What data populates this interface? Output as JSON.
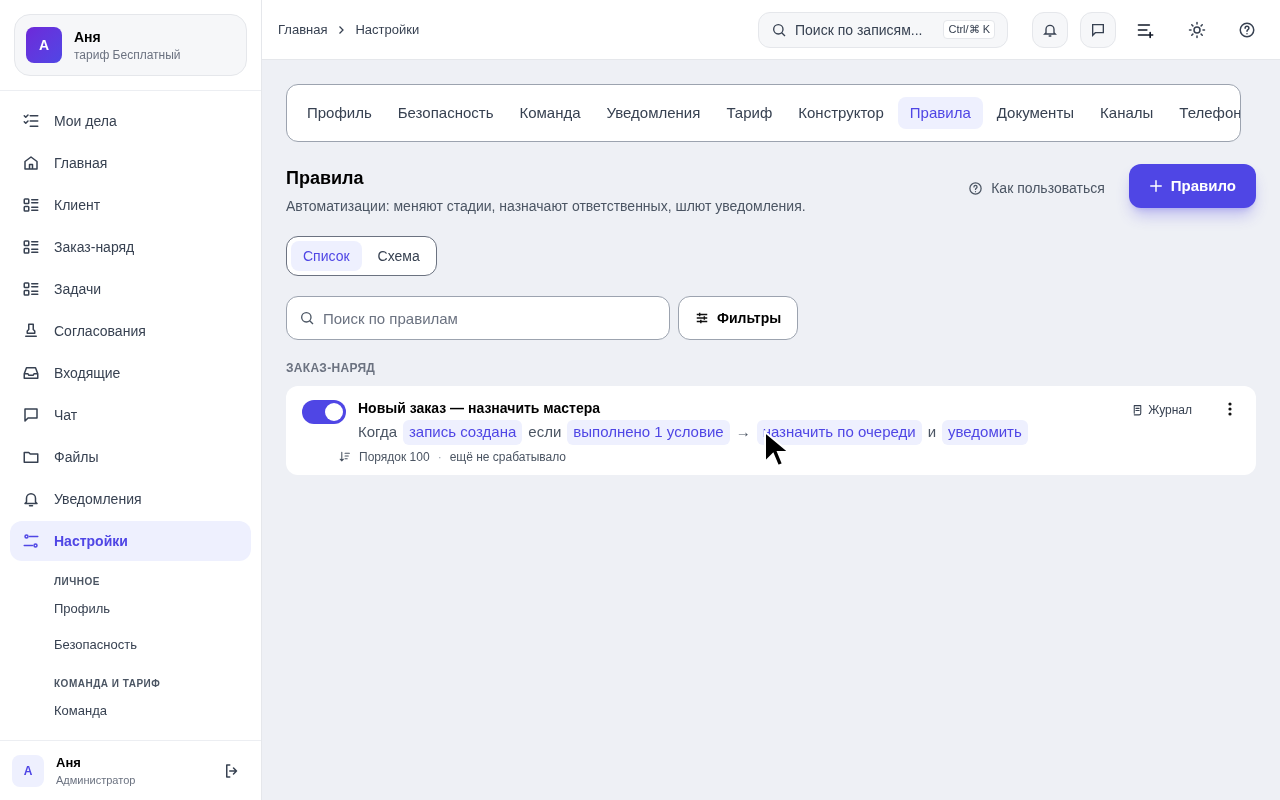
{
  "account": {
    "avatar": "А",
    "name": "Аня",
    "plan": "тариф Бесплатный"
  },
  "nav": [
    {
      "label": "Мои дела",
      "selected": false
    },
    {
      "label": "Главная",
      "selected": false
    },
    {
      "label": "Клиент",
      "selected": false
    },
    {
      "label": "Заказ-наряд",
      "selected": false
    },
    {
      "label": "Задачи",
      "selected": false
    },
    {
      "label": "Согласования",
      "selected": false
    },
    {
      "label": "Входящие",
      "selected": false
    },
    {
      "label": "Чат",
      "selected": false
    },
    {
      "label": "Файлы",
      "selected": false
    },
    {
      "label": "Уведомления",
      "selected": false
    },
    {
      "label": "Настройки",
      "selected": true
    }
  ],
  "subnav": [
    {
      "kind": "heading",
      "label": "ЛИЧНОЕ"
    },
    {
      "kind": "link",
      "label": "Профиль"
    },
    {
      "kind": "link",
      "label": "Безопасность"
    },
    {
      "kind": "heading",
      "label": "КОМАНДА И ТАРИФ"
    },
    {
      "kind": "link",
      "label": "Команда"
    }
  ],
  "user": {
    "avatar": "А",
    "name": "Аня",
    "role": "Администратор"
  },
  "breadcrumbs": [
    "Главная",
    "Настройки"
  ],
  "search": {
    "placeholder": "Поиск по записям...",
    "shortcut": "Ctrl/⌘ K"
  },
  "tabs": [
    {
      "label": "Профиль",
      "selected": false
    },
    {
      "label": "Безопасность",
      "selected": false
    },
    {
      "label": "Команда",
      "selected": false
    },
    {
      "label": "Уведомления",
      "selected": false
    },
    {
      "label": "Тариф",
      "selected": false
    },
    {
      "label": "Конструктор",
      "selected": false
    },
    {
      "label": "Правила",
      "selected": true
    },
    {
      "label": "Документы",
      "selected": false
    },
    {
      "label": "Каналы",
      "selected": false
    },
    {
      "label": "Телефон",
      "selected": false
    }
  ],
  "page": {
    "title": "Правила",
    "subtitle": "Автоматизации: меняют стадии, назначают ответственных, шлют уведомления.",
    "help": "Как пользоваться",
    "add_button": "Правило"
  },
  "views": [
    {
      "label": "Список",
      "selected": true
    },
    {
      "label": "Схема",
      "selected": false
    }
  ],
  "rule_search": {
    "placeholder": "Поиск по правилам"
  },
  "filters_button": "Фильтры",
  "group": {
    "title": "ЗАКАЗ-НАРЯД",
    "rules": [
      {
        "on": true,
        "title": "Новый заказ — назначить мастера",
        "parts": [
          {
            "kind": "text",
            "text": "Когда"
          },
          {
            "kind": "chip",
            "text": "запись создана"
          },
          {
            "kind": "text",
            "text": "если"
          },
          {
            "kind": "chip",
            "text": "выполнено 1 условие"
          },
          {
            "kind": "text",
            "text": "→"
          },
          {
            "kind": "chip",
            "text": "назначить по очереди"
          },
          {
            "kind": "text",
            "text": "и"
          },
          {
            "kind": "chip",
            "text": "уведомить"
          }
        ],
        "order": "Порядок 100",
        "separator": "·",
        "last_run": "ещё не срабатывало",
        "journal": "Журнал"
      }
    ]
  }
}
